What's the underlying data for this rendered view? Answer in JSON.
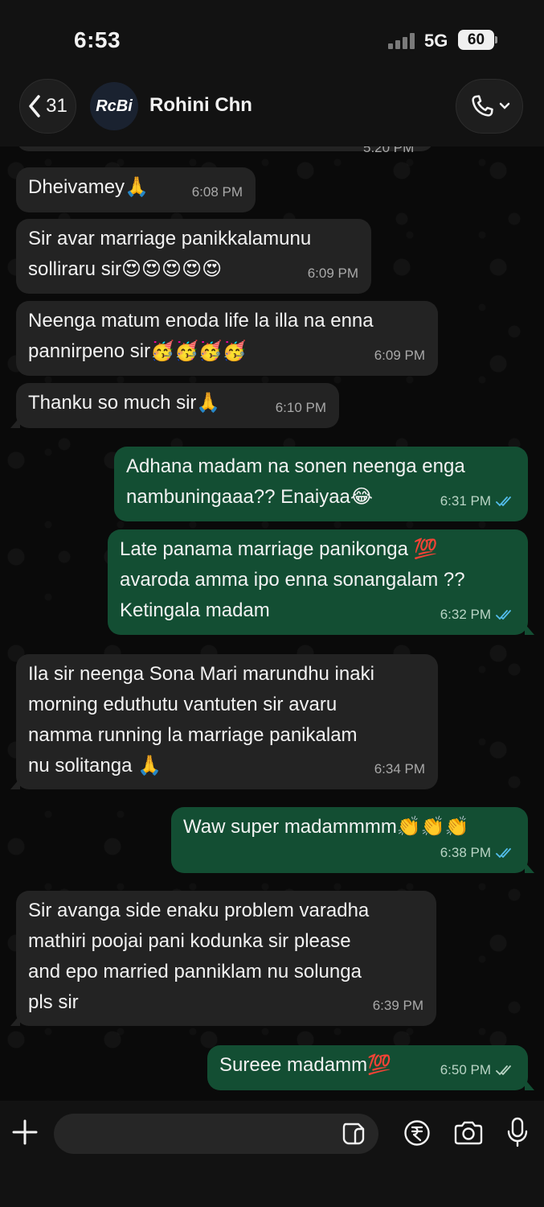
{
  "status_bar": {
    "time": "6:53",
    "network": "5G",
    "battery": "60"
  },
  "header": {
    "back_count": "31",
    "avatar_text": "RcBi",
    "contact_name": "Rohini Chn"
  },
  "chat": {
    "partial_time": "5:20 PM",
    "messages": [
      {
        "dir": "in",
        "text": "Dheivamey🙏",
        "time": "6:08 PM"
      },
      {
        "dir": "in",
        "text": "Sir avar marriage panikkalamunu\nsolliraru sir😍😍😍😍😍",
        "time": "6:09 PM"
      },
      {
        "dir": "in",
        "text": "Neenga matum enoda life la illa na enna\npannirpeno sir🥳🥳🥳🥳",
        "time": "6:09 PM"
      },
      {
        "dir": "in",
        "text": "Thanku so much sir🙏",
        "time": "6:10 PM"
      },
      {
        "dir": "out",
        "text": "Adhana madam na sonen neenga enga\nnambuningaaa?? Enaiyaa😂",
        "time": "6:31 PM",
        "status": "read"
      },
      {
        "dir": "out",
        "text": "Late panama marriage panikonga 💯\navaroda amma ipo enna sonangalam ??\nKetingala madam",
        "time": "6:32 PM",
        "status": "read"
      },
      {
        "dir": "in",
        "text": "Ila sir neenga Sona Mari marundhu inaki\nmorning eduthutu vantuten sir avaru\nnamma running la marriage panikalam\nnu solitanga 🙏",
        "time": "6:34 PM"
      },
      {
        "dir": "out",
        "text": "Waw super madammmm👏👏👏",
        "time": "6:38 PM",
        "status": "read"
      },
      {
        "dir": "in",
        "text": "Sir avanga side enaku problem varadha\nmathiri poojai pani kodunka sir please\nand epo married panniklam nu solunga\npls sir",
        "time": "6:39 PM"
      },
      {
        "dir": "out",
        "text": "Sureee madamm💯",
        "time": "6:50 PM",
        "status": "delivered"
      }
    ]
  },
  "input_bar": {
    "placeholder": ""
  },
  "colors": {
    "incoming_bubble": "#232323",
    "outgoing_bubble": "#134e33",
    "read_tick": "#53bdeb",
    "delivered_tick": "#b9d4c5"
  },
  "icons": [
    "back-chevron-icon",
    "call-icon",
    "chevron-down-icon",
    "plus-icon",
    "sticker-icon",
    "rupee-icon",
    "camera-icon",
    "mic-icon"
  ]
}
